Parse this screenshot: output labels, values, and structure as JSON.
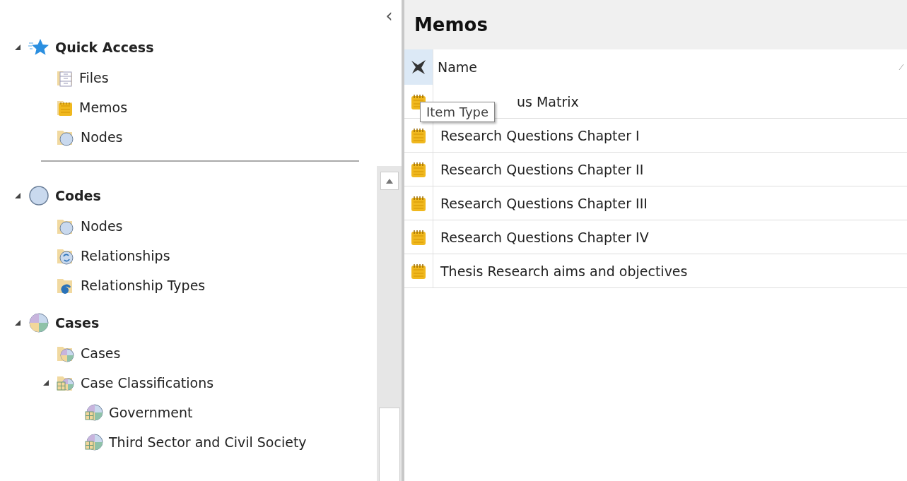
{
  "navigation": {
    "collapse_button": "‹",
    "sections": [
      {
        "label": "Quick Access",
        "kind": "quick_access",
        "expanded": true,
        "items": [
          {
            "label": "Files"
          },
          {
            "label": "Memos"
          },
          {
            "label": "Nodes"
          }
        ]
      },
      {
        "label": "Codes",
        "kind": "group",
        "expanded": true,
        "items": [
          {
            "label": "Nodes"
          },
          {
            "label": "Relationships"
          },
          {
            "label": "Relationship Types"
          }
        ]
      },
      {
        "label": "Cases",
        "kind": "group",
        "expanded": true,
        "items": [
          {
            "label": "Cases"
          },
          {
            "label": "Case Classifications",
            "expanded": true,
            "children": [
              {
                "label": "Government"
              },
              {
                "label": "Third Sector and Civil Society"
              }
            ]
          }
        ]
      }
    ]
  },
  "list_view": {
    "title": "Memos",
    "columns": [
      {
        "kind": "type",
        "highlighted": true
      },
      {
        "kind": "name",
        "label": "Name"
      }
    ],
    "rows": [
      {
        "name": "us Matrix"
      },
      {
        "name": "Research Questions Chapter I"
      },
      {
        "name": "Research Questions Chapter II"
      },
      {
        "name": "Research Questions Chapter III"
      },
      {
        "name": "Research Questions Chapter IV"
      },
      {
        "name": "Thesis Research aims and objectives"
      }
    ],
    "tooltip": "Item Type"
  }
}
